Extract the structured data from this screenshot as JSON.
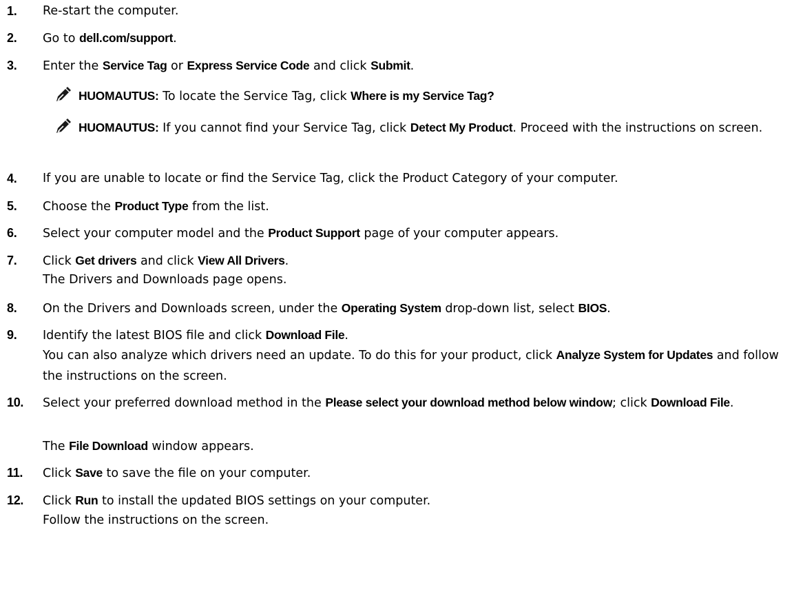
{
  "steps": [
    {
      "num": "1.",
      "parts": [
        {
          "t": "Re-start the computer."
        }
      ]
    },
    {
      "num": "2.",
      "parts": [
        {
          "t": "Go to "
        },
        {
          "t": "dell.com/support",
          "b": true
        },
        {
          "t": "."
        }
      ]
    },
    {
      "num": "3.",
      "parts": [
        {
          "t": "Enter the "
        },
        {
          "t": "Service Tag",
          "b": true
        },
        {
          "t": " or "
        },
        {
          "t": "Express Service Code",
          "b": true
        },
        {
          "t": " and click "
        },
        {
          "t": "Submit",
          "b": true
        },
        {
          "t": "."
        }
      ]
    },
    {
      "num": "4.",
      "parts": [
        {
          "t": "If you are unable to locate or find the Service Tag, click the Product Category of your computer."
        }
      ]
    },
    {
      "num": "5.",
      "parts": [
        {
          "t": "Choose the "
        },
        {
          "t": "Product Type",
          "b": true
        },
        {
          "t": " from the list."
        }
      ]
    },
    {
      "num": "6.",
      "parts": [
        {
          "t": "Select your computer model and the "
        },
        {
          "t": "Product Support",
          "b": true
        },
        {
          "t": " page of your computer appears."
        }
      ]
    },
    {
      "num": "7.",
      "parts": [
        {
          "t": "Click "
        },
        {
          "t": "Get drivers",
          "b": true
        },
        {
          "t": " and click "
        },
        {
          "t": "View All Drivers",
          "b": true
        },
        {
          "t": "."
        }
      ]
    },
    {
      "num": "8.",
      "parts": [
        {
          "t": "On the Drivers and Downloads screen, under the "
        },
        {
          "t": "Operating System",
          "b": true
        },
        {
          "t": " drop-down list, select "
        },
        {
          "t": "BIOS",
          "b": true
        },
        {
          "t": "."
        }
      ]
    },
    {
      "num": "9.",
      "parts": [
        {
          "t": "Identify the latest BIOS file and click "
        },
        {
          "t": "Download File",
          "b": true
        },
        {
          "t": "."
        }
      ]
    },
    {
      "num": "10.",
      "parts": [
        {
          "t": "Select your preferred download method in the "
        },
        {
          "t": "Please select your download method below window",
          "b": true
        },
        {
          "t": "; click "
        },
        {
          "t": "Download File",
          "b": true
        },
        {
          "t": "."
        }
      ]
    },
    {
      "num": "11.",
      "parts": [
        {
          "t": "Click "
        },
        {
          "t": "Save",
          "b": true
        },
        {
          "t": " to save the file on your computer."
        }
      ]
    },
    {
      "num": "12.",
      "parts": [
        {
          "t": "Click "
        },
        {
          "t": "Run",
          "b": true
        },
        {
          "t": " to install the updated BIOS settings on your computer."
        }
      ]
    }
  ],
  "notes": [
    {
      "label": "HUOMAUTUS:",
      "parts": [
        {
          "t": " To locate the Service Tag, click "
        },
        {
          "t": "Where is my Service Tag?",
          "b": true
        }
      ]
    },
    {
      "label": "HUOMAUTUS:",
      "parts": [
        {
          "t": " If you cannot find your Service Tag, click "
        },
        {
          "t": "Detect My Product",
          "b": true
        },
        {
          "t": ". Proceed with the instructions on screen."
        }
      ]
    }
  ],
  "followups": {
    "step7": [
      {
        "t": "The Drivers and Downloads page opens."
      }
    ],
    "step9": [
      {
        "t": "You can also analyze which drivers need an update. To do this for your product, click "
      },
      {
        "t": "Analyze System for Updates",
        "b": true
      },
      {
        "t": " and follow the instructions on the screen."
      }
    ],
    "step10": [
      {
        "t": "The "
      },
      {
        "t": "File Download",
        "b": true
      },
      {
        "t": " window appears."
      }
    ],
    "step12": [
      {
        "t": "Follow the instructions on the screen."
      }
    ]
  }
}
